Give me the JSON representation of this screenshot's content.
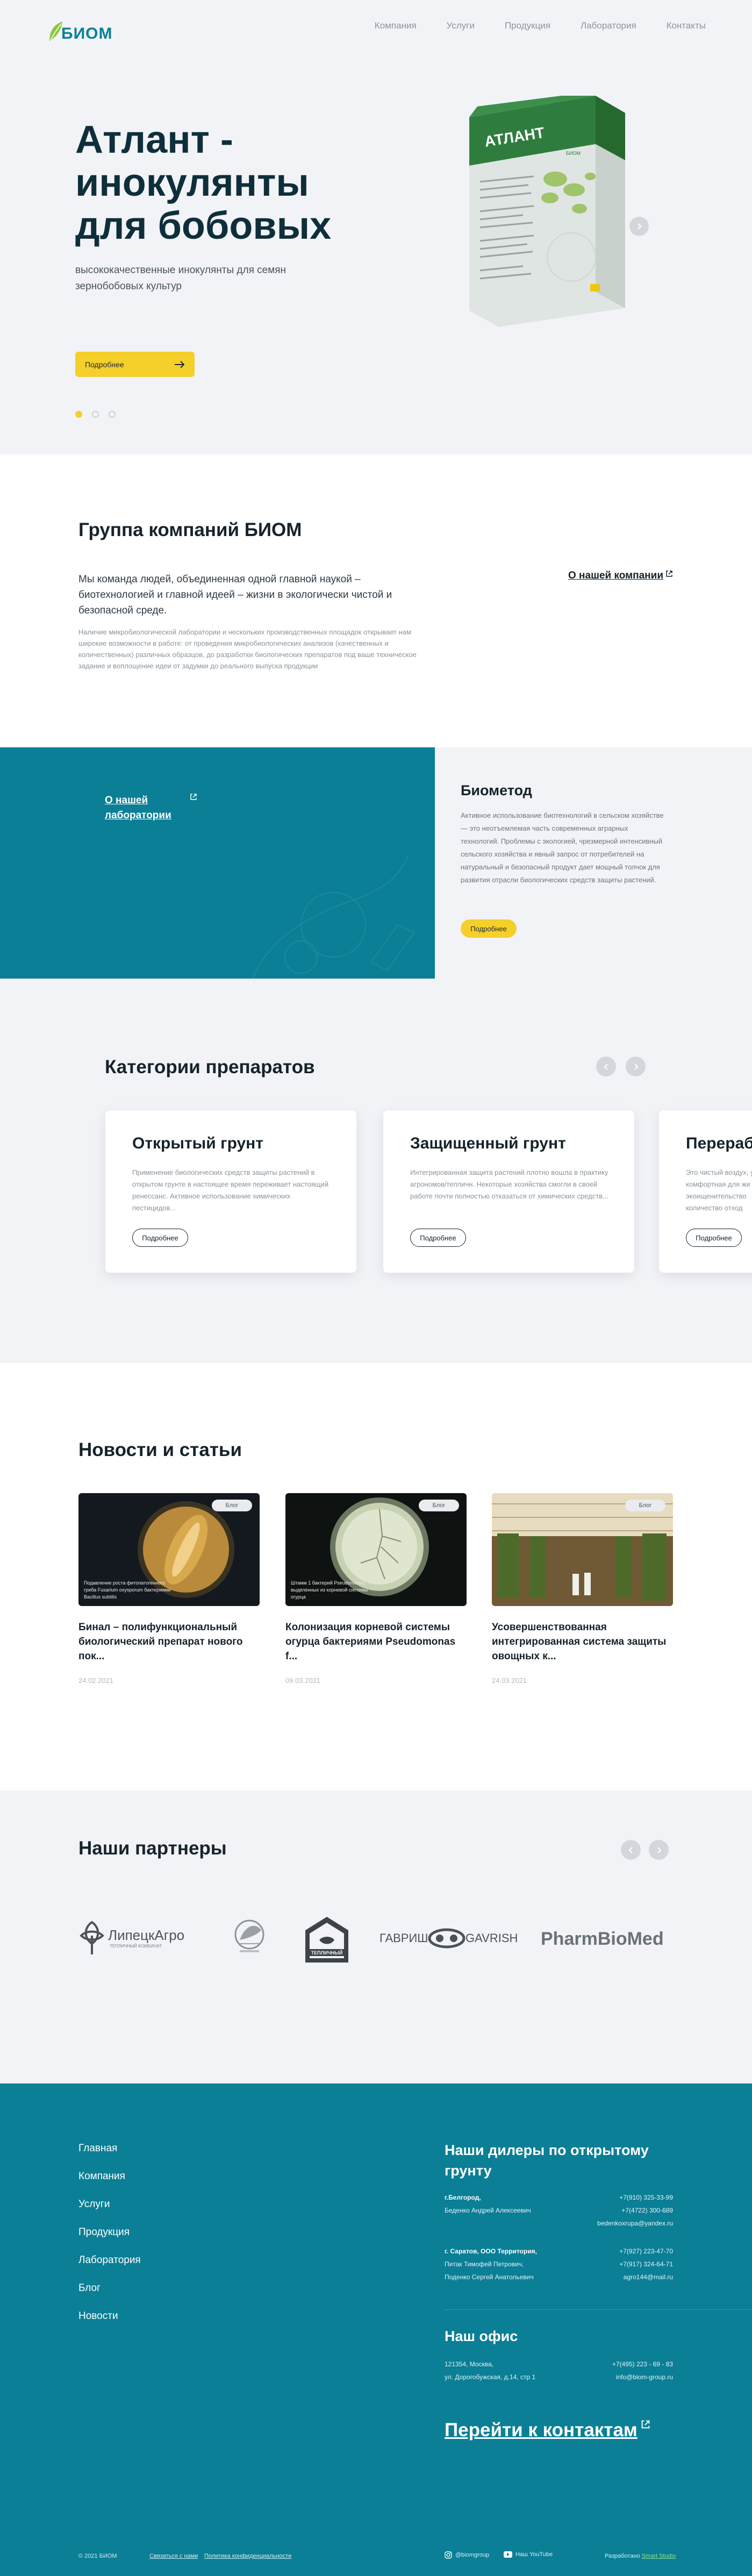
{
  "header": {
    "logo": "БИОМ",
    "nav": [
      "Компания",
      "Услуги",
      "Продукция",
      "Лаборатория",
      "Контакты"
    ]
  },
  "hero": {
    "title": "Атлант - инокулянты для бобовых",
    "subtitle": "высококачественные инокулянты для семян зернобобовых культур",
    "button": "Подробнее",
    "package_brand": "АТЛАНТ",
    "package_logo": "БИОМ",
    "slide_count": 3,
    "active_slide": 1
  },
  "group": {
    "title": "Группа компаний БИОМ",
    "lead": "Мы команда людей, объединенная одной главной наукой – биотехнологией и главной идеей – жизни в экологически чистой и безопасной среде.",
    "text": "Наличие микробиологической лаборатории и нескольких производственных площадок открывает нам широкие возможности в работе: от проведения микробиологических анализов (качественных и количественных) различных образцов, до разработки биологических препаратов под ваше техническое задание и воплощение идеи от задумки до реального выпуска продукции",
    "link": "О нашей компании"
  },
  "lab": {
    "link": "О нашей лаборатории",
    "title": "Биометод",
    "text": "Активное использование биотехнологий в сельском хозяйстве — это неотъемлемая часть современных аграрных технологий. Проблемы с экологией, чрезмерной интенсивный сельского хозяйства и явный запрос от потребителей на натуральный и безопасный продукт дает мощный толчок для развития отрасли биологических средств защиты растений.",
    "button": "Подробнее"
  },
  "categories": {
    "title": "Категории препаратов",
    "cards": [
      {
        "title": "Открытый грунт",
        "text": "Применение биологических средств защиты растений в открытом грунте в настоящее время переживает настоящий ренессанс. Активное использование химических пестицидов...",
        "button": "Подробнее"
      },
      {
        "title": "Защищенный грунт",
        "text": "Интегрированная защита растений плотно вошла в практику агрономов/тепличн. Некоторые хозяйства смогли в своей работе почти полностью отказаться от химических средств...",
        "button": "Подробнее"
      },
      {
        "title": "Перерабо",
        "text": "Это чистый воздух, у комфортная для жи экоищенительство количество отход",
        "button": "Подробнее"
      }
    ]
  },
  "news": {
    "title": "Новости и статьи",
    "items": [
      {
        "tag": "Блог",
        "caption": "Подавление роста фитопатогенного гриба Fusarium oxysporum бактериями Bacillus subtilis",
        "title": "Бинал – полифункциональный биологический препарат нового пок...",
        "date": "24.02.2021"
      },
      {
        "tag": "Блог",
        "caption": "Штамм 1 бактерий Pseudomonas, выделенных из корневой системы огурца",
        "title": "Колонизация корневой системы огурца бактериями Pseudomonas f...",
        "date": "09.03.2021"
      },
      {
        "tag": "Блог",
        "caption": "",
        "title": "Усовершенствованная интегрированная система защиты овощных к...",
        "date": "24.03.2021"
      }
    ]
  },
  "partners": {
    "title": "Наши партнеры",
    "logos": [
      "ЛипецкАгро",
      "Агрокомплекс",
      "ТЕПЛИЧНЫЙ",
      "ГАВРИШ GAVRISH",
      "PharmBioMed"
    ],
    "logo_text": {
      "lipetsk": "ЛипецкАгро",
      "lipetsk_sub": "ТЕПЛИЧНЫЙ КОМБИНАТ",
      "teplich": "ТЕПЛИЧНЫЙ",
      "gavrish_left": "ГАВРИШ",
      "gavrish_right": "GAVRISH",
      "pharm": "PharmBioMed"
    }
  },
  "footer": {
    "nav": [
      "Главная",
      "Компания",
      "Услуги",
      "Продукция",
      "Лаборатория",
      "Блог",
      "Новости"
    ],
    "dealers_title": "Наши дилеры по открытому грунту",
    "dealers": [
      {
        "city": "г.Белгород,",
        "names": [
          "Беденко Андрей Алексеевич"
        ],
        "contacts": [
          "+7(910) 325-33-99",
          "+7(4722) 300-689",
          "bedenkoxrupa@yandex.ru"
        ]
      },
      {
        "city": "г. Саратов, ООО Территория,",
        "names": [
          "Питак Тимофей Петрович,",
          "Поденко Сергей Анатольевич"
        ],
        "contacts": [
          "+7(927) 223-47-70",
          "+7(917) 324-64-71",
          "agro144@mail.ru"
        ]
      }
    ],
    "office_title": "Наш офис",
    "office_address": [
      "121354, Москва,",
      "ул. Дорогобужская, д.14, стр 1"
    ],
    "office_contacts": [
      "+7(495) 223 - 69 - 83",
      "info@biom-group.ru"
    ],
    "contacts_link": "Перейти к контактам",
    "copyright": "© 2021 БИОМ",
    "contact_us": "Связаться с нами",
    "privacy": "Политика конфиденциальности",
    "instagram": "@biomgroup",
    "youtube": "Наш YouTube",
    "dev_prefix": "Разработано",
    "dev_name": "Smart Studio"
  },
  "colors": {
    "teal": "#0a7f96",
    "yellow": "#f5cf2a",
    "dark": "#16232b"
  }
}
